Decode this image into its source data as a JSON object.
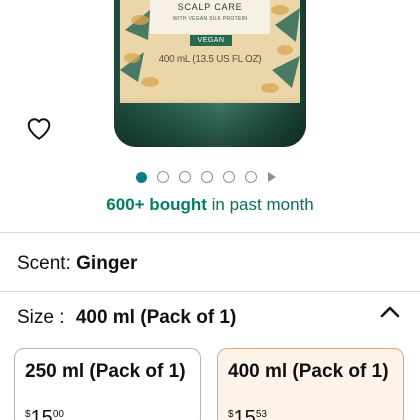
{
  "product_image": {
    "label_title": "SCALP CARE",
    "label_subtitle": "WITH VEGAN SILK PROTEIN",
    "vegan_badge": "VEGAN",
    "volume_text": "400 mL (13.5 US FL OZ)",
    "label_color": "#ead6a8",
    "bottle_color": "#2e6a56"
  },
  "wishlist": {
    "icon": "heart-icon"
  },
  "carousel": {
    "total_images": 6,
    "active_index": 0,
    "has_video": true
  },
  "social_proof": {
    "count": "600+ bought",
    "suffix": "in past month",
    "color": "#067d62"
  },
  "scent": {
    "label": "Scent:",
    "value": "Ginger"
  },
  "size": {
    "label": "Size :",
    "value": "400 ml (Pack of 1)",
    "expanded_icon": "chevron-up-icon",
    "options": [
      {
        "label": "250 ml (Pack of 1)",
        "currency": "$",
        "whole": "15",
        "fraction": "00",
        "selected": false
      },
      {
        "label": "400 ml (Pack of 1)",
        "currency": "$",
        "whole": "15",
        "fraction": "53",
        "selected": true
      }
    ]
  }
}
